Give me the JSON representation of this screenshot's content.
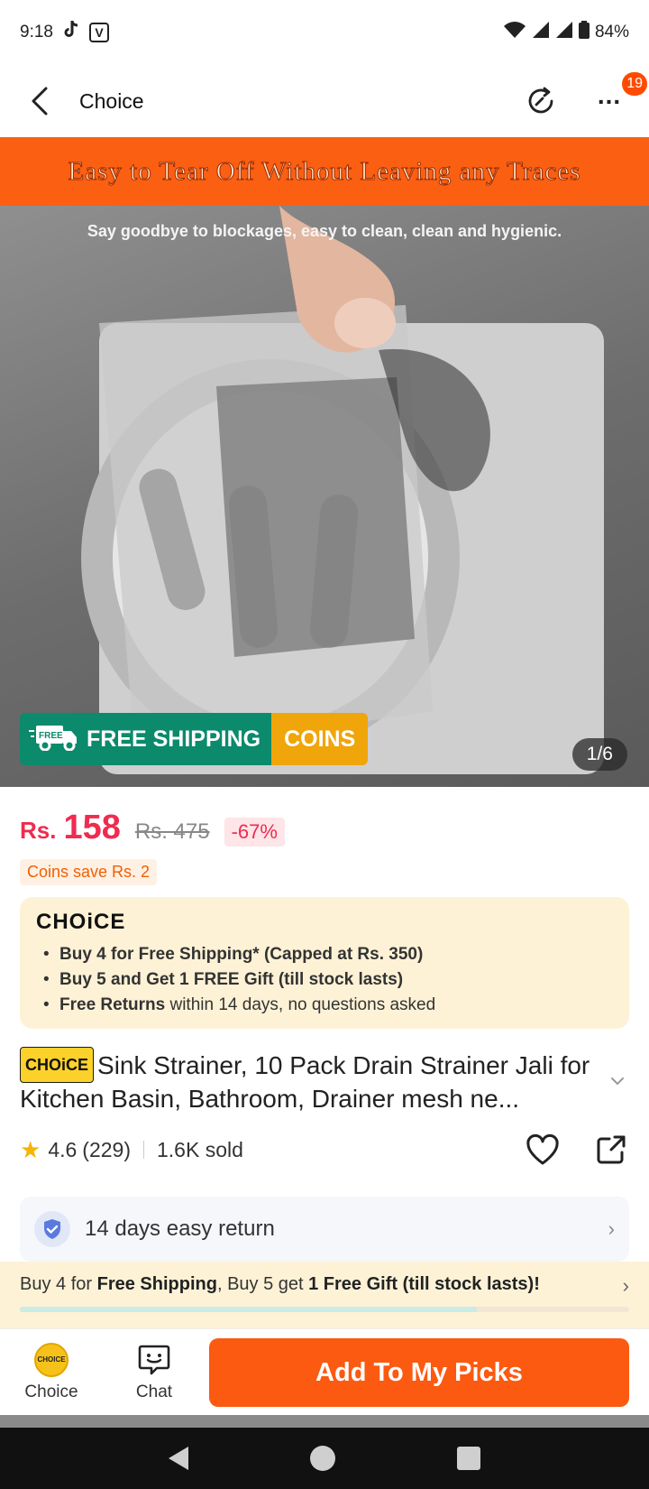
{
  "status": {
    "time": "9:18",
    "battery": "84%",
    "icons": [
      "tiktok-icon",
      "v-icon",
      "wifi-icon",
      "signal-icon",
      "battery-icon"
    ]
  },
  "nav": {
    "title": "Choice",
    "badge_count": "19"
  },
  "gallery": {
    "banner": "Easy to Tear Off Without Leaving any Traces",
    "caption": "Say goodbye to blockages, easy to clean, clean and hygienic.",
    "ship_label": "FREE SHIPPING",
    "ship_truck_text": "FREE",
    "coins_label": "COINS",
    "counter": "1/6"
  },
  "price": {
    "currency": "Rs.",
    "current": "158",
    "original": "Rs. 475",
    "discount": "-67%",
    "coins_save": "Coins save Rs. 2"
  },
  "choice_box": {
    "logo": "CHOiCE",
    "items": [
      {
        "bold": "Buy 4 for  Free Shipping* (Capped at Rs. 350)",
        "rest": ""
      },
      {
        "bold": "Buy 5 and Get 1 FREE Gift (till stock lasts)",
        "rest": ""
      },
      {
        "bold": "Free Returns",
        "rest": " within 14 days, no questions asked"
      }
    ]
  },
  "product": {
    "tag": "CHOiCE",
    "title": "Sink Strainer, 10 Pack Drain Strainer Jali for Kitchen Basin, Bathroom, Drainer mesh ne...",
    "rating": "4.6",
    "reviews": "(229)",
    "sold": "1.6K sold"
  },
  "return": {
    "label": "14 days easy return"
  },
  "promo": {
    "part1": "Buy 4 for ",
    "bold1": "Free Shipping",
    "part2": ", Buy 5 get ",
    "bold2": "1 Free Gift (till stock lasts)!",
    "progress": 0.75
  },
  "bottom": {
    "tab_choice": "Choice",
    "tab_choice_icon_text": "CHOICE",
    "tab_chat": "Chat",
    "cta": "Add To My Picks"
  },
  "colors": {
    "accent": "#fb5a10",
    "price": "#f02b50",
    "choice_bg": "#fdf2d6",
    "ship_green": "#0b8a6c",
    "coins_yellow": "#f0a50a"
  }
}
